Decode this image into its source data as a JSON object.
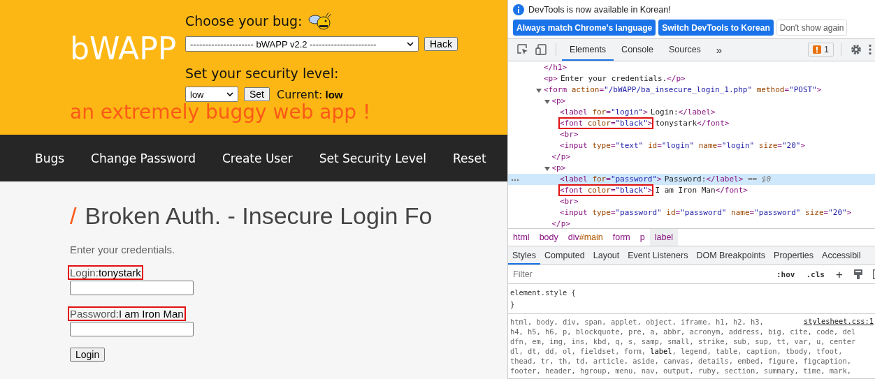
{
  "header": {
    "logo": "bWAPP",
    "tagline": "an extremely buggy web app !",
    "bug_label": "Choose your bug:",
    "bug_select": "--------------------- bWAPP v2.2 ----------------------",
    "hack_button": "Hack",
    "security_label": "Set your security level:",
    "security_select": "low",
    "set_button": "Set",
    "current_label": "Current:",
    "current_value": "low"
  },
  "nav": [
    "Bugs",
    "Change Password",
    "Create User",
    "Set Security Level",
    "Reset"
  ],
  "page": {
    "title_mark": "/",
    "title": "Broken Auth. - Insecure Login Fo",
    "intro": "Enter your credentials.",
    "fields": [
      {
        "label": "Login:",
        "value": "tonystark",
        "highlighted": true
      },
      {
        "label": "Password:",
        "value": "I am Iron Man",
        "highlighted": true
      }
    ],
    "login_button": "Login"
  },
  "devtools": {
    "infobar": {
      "message": "DevTools is now available in Korean!",
      "buttons": [
        {
          "label": "Always match Chrome's language",
          "kind": "primary"
        },
        {
          "label": "Switch DevTools to Korean",
          "kind": "primary"
        },
        {
          "label": "Don't show again",
          "kind": "secondary"
        }
      ]
    },
    "tabs": [
      {
        "label": "Elements",
        "selected": true
      },
      {
        "label": "Console",
        "selected": false
      },
      {
        "label": "Sources",
        "selected": false
      }
    ],
    "more_tabs": "»",
    "issues_count": "1",
    "tree": [
      {
        "open": "</h1>",
        "selected": false
      },
      {
        "open": "<p>",
        "content": "Enter your credentials.",
        "close": "</p>",
        "selected": false
      },
      {
        "open": "<form action=\"/bWAPP/ba_insecure_login_1.php\" method=\"POST\">",
        "selected": false,
        "expanded": true,
        "children": [
          {
            "open": "<p>",
            "selected": false,
            "expanded": true,
            "closing": "</p>",
            "children": [
              {
                "open": "<label for=\"login\">",
                "content": "Login:",
                "close": "</label>",
                "selected": false
              },
              {
                "open": "<font color=\"black\">",
                "content": "tonystark",
                "close": "</font>",
                "selected": false,
                "highlighted": true
              },
              {
                "open": "<br>",
                "selected": false
              },
              {
                "open": "<input type=\"text\" id=\"login\" name=\"login\" size=\"20\">",
                "selected": false
              }
            ]
          },
          {
            "open": "<p>",
            "selected": false,
            "expanded": true,
            "closing": "</p>",
            "children": [
              {
                "open": "<label for=\"password\">",
                "content": "Password:",
                "close": "</label>",
                "selected": true,
                "suffix": "== $0"
              },
              {
                "open": "<font color=\"black\">",
                "content": "I am Iron Man",
                "close": "</font>",
                "selected": false,
                "highlighted": true
              },
              {
                "open": "<br>",
                "selected": false
              },
              {
                "open": "<input type=\"password\" id=\"password\" name=\"password\" size=\"20\">",
                "selected": false
              }
            ]
          }
        ]
      }
    ],
    "breadcrumbs": [
      {
        "label": "html",
        "selected": false
      },
      {
        "label": "body",
        "selected": false
      },
      {
        "label": "div#main",
        "selected": false
      },
      {
        "label": "form",
        "selected": false
      },
      {
        "label": "p",
        "selected": false
      },
      {
        "label": "label",
        "selected": true
      }
    ],
    "style_tabs": [
      {
        "label": "Styles",
        "selected": true
      },
      {
        "label": "Computed",
        "selected": false
      },
      {
        "label": "Layout",
        "selected": false
      },
      {
        "label": "Event Listeners",
        "selected": false
      },
      {
        "label": "DOM Breakpoints",
        "selected": false
      },
      {
        "label": "Properties",
        "selected": false
      },
      {
        "label": "Accessibil",
        "selected": false
      }
    ],
    "filter": {
      "placeholder": "Filter"
    },
    "hov": ":hov",
    "cls": ".cls",
    "add": "+",
    "element_style": [
      "element.style {",
      "}"
    ],
    "rule_source": "stylesheet.css:1",
    "rule_lines": [
      "html, body, div, span, applet, object, iframe, h1, h2, h3,",
      "h4, h5, h6, p, blockquote, pre, a, abbr, acronym, address, big, cite, code, del",
      "dfn, em, img, ins, kbd, q, s, samp, small, strike, sub, sup, tt, var, u, center",
      "dl, dt, dd, ol, fieldset, form, **label**, legend, table, caption, tbody, tfoot,",
      "thead, tr, th, td, article, aside, canvas, details, embed, figure, figcaption,",
      "footer, header, hgroup, menu, nav, output, ruby, section, summary, time, mark,"
    ]
  }
}
